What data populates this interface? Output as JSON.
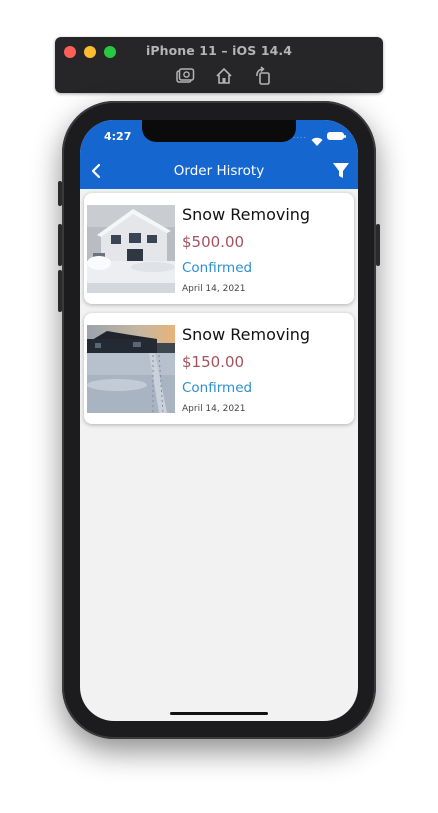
{
  "simulator": {
    "title": "iPhone 11 – iOS 14.4"
  },
  "status_bar": {
    "time": "4:27"
  },
  "nav": {
    "title": "Order Hisroty"
  },
  "orders": [
    {
      "title": "Snow Removing",
      "price": "$500.00",
      "status": "Confirmed",
      "date": "April 14, 2021",
      "image": "snowy-house-photo"
    },
    {
      "title": "Snow Removing",
      "price": "$150.00",
      "status": "Confirmed",
      "date": "April 14, 2021",
      "image": "snowy-yard-photo"
    }
  ],
  "colors": {
    "header": "#1666d0",
    "price": "#a5525e",
    "status": "#2b8fd0",
    "background": "#f2f2f2"
  },
  "icons": [
    "screenshot-icon",
    "home-icon",
    "rotate-icon",
    "back-chevron-icon",
    "filter-icon",
    "wifi-icon",
    "battery-icon"
  ]
}
